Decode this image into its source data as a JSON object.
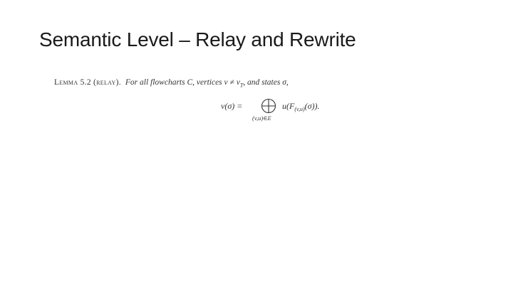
{
  "slide": {
    "title": "Semantic Level – Relay and Rewrite"
  },
  "lemma": {
    "heading": "Lemma 5.2 (relay).",
    "statement": "For all flowcharts C, vertices v ≠ v",
    "statement_sub": "T",
    "statement_tail": ", and states σ,",
    "equation_lhs": "v(σ) =",
    "equation_operator_icon": "circled-plus-icon",
    "equation_subscript": "(v,u)∈E",
    "equation_rhs_pre": "u(F",
    "equation_rhs_sub": "(v,u)",
    "equation_rhs_post": "(σ))."
  }
}
